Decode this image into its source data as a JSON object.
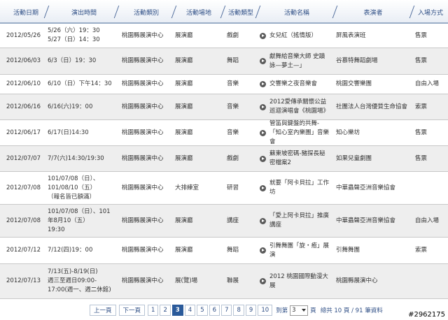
{
  "headers": [
    "活動日期",
    "演出時間",
    "活動類別",
    "活動場地",
    "活動類型",
    "活動名稱",
    "表演者",
    "入場方式"
  ],
  "rows": [
    {
      "date": "2012/05/26",
      "time": "5/26（六）19：30\n5/27（日）14：30",
      "org": "桃園縣展演中心",
      "venue": "展演廳",
      "type": "戲劇",
      "name": "女兒紅（搖情版）",
      "performer": "屏風表演班",
      "entry": "售票"
    },
    {
      "date": "2012/06/03",
      "time": "6/3（日）19：30",
      "org": "桃園縣展演中心",
      "venue": "展演廳",
      "type": "舞蹈",
      "name": "獻舞給音樂大師 史蹟詠—夢土—」",
      "performer": "谷慕特舞蹈劇場",
      "entry": "售票"
    },
    {
      "date": "2012/06/10",
      "time": "6/10（日）下午14：30",
      "org": "桃園縣展演中心",
      "venue": "展演廳",
      "type": "音樂",
      "name": "交響樂之夜音樂會",
      "performer": "桃園交響樂團",
      "entry": "自由入場"
    },
    {
      "date": "2012/06/16",
      "time": "6/16(六)19：00",
      "org": "桃園縣展演中心",
      "venue": "展演廳",
      "type": "音樂",
      "name": "2012愛傳承關懷公益巡迴演唱會《桃園場》",
      "performer": "社團法人台灣優質生命協會",
      "entry": "索票"
    },
    {
      "date": "2012/06/17",
      "time": "6/17(日)14:30",
      "org": "桃園縣展演中心",
      "venue": "展演廳",
      "type": "音樂",
      "name": "管笛與鍵盤的共舞-「知心室內樂團」音樂會",
      "performer": "知心樂坊",
      "entry": "售票"
    },
    {
      "date": "2012/07/07",
      "time": "7/7(六)14:30/19:30",
      "org": "桃園縣展演中心",
      "venue": "展演廳",
      "type": "戲劇",
      "name": "蘇東坡密碼-豬探長秘密檔案2",
      "performer": "如果兒童劇團",
      "entry": "售票"
    },
    {
      "date": "2012/07/08",
      "time": "101/07/08（日）、\n101/08/10（五）\n（報名皆已額滿）",
      "org": "桃園縣展演中心",
      "venue": "大排練室",
      "type": "研習",
      "name": "就要「阿卡貝拉」工作坊",
      "performer": "中華蟲聲亞洲音樂協會",
      "entry": ""
    },
    {
      "date": "2012/07/08",
      "time": "101/07/08（日）、101年8月10（五）\n19:30",
      "org": "桃園縣展演中心",
      "venue": "展演廳",
      "type": "講座",
      "name": "「愛上阿卡貝拉」推廣講座",
      "performer": "中華蟲聲亞洲音樂協會",
      "entry": "自由入場"
    },
    {
      "date": "2012/07/12",
      "time": "7/12(四)19：00",
      "org": "桃園縣展演中心",
      "venue": "展演廳",
      "type": "舞蹈",
      "name": "引舞舞團「旋・癒」展演",
      "performer": "引舞舞團",
      "entry": "索票"
    },
    {
      "date": "2012/07/13",
      "time": "7/13(五)-8/19(日)\n週三至週日09:00-17:00(週一、週二休館)",
      "org": "桃園縣展演中心",
      "venue": "展(覽)場",
      "type": "聯展",
      "name": "2012 桃園國際動漫大展",
      "performer": "桃園縣展演中心",
      "entry": ""
    }
  ],
  "pager": {
    "prev": "上一頁",
    "next": "下一頁",
    "pages": [
      "1",
      "2",
      "3",
      "4",
      "5",
      "6",
      "7",
      "8",
      "9",
      "10"
    ],
    "current": "3",
    "goto_label": "到第",
    "goto_value": "3",
    "page_unit": "頁",
    "summary": "總共 10 頁 / 91 筆資料"
  },
  "watermark": "#2962175"
}
